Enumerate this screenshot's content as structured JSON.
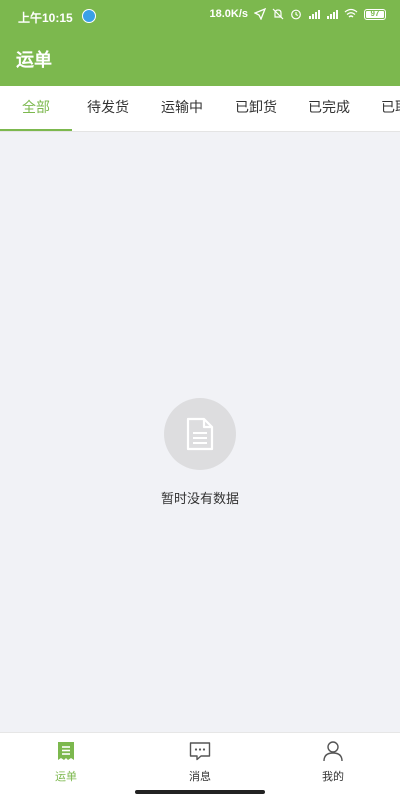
{
  "status_bar": {
    "time": "上午10:15",
    "speed": "18.0K/s",
    "battery": "97",
    "icons": [
      "check-badge-icon",
      "location-arrow-icon",
      "bell-off-icon",
      "alarm-icon",
      "hd-signal-icon",
      "signal-icon",
      "wifi-icon",
      "battery-icon"
    ]
  },
  "header": {
    "title": "运单",
    "background_color": "#7cb84e"
  },
  "tabs": [
    {
      "label": "全部",
      "active": true
    },
    {
      "label": "待发货",
      "active": false
    },
    {
      "label": "运输中",
      "active": false
    },
    {
      "label": "已卸货",
      "active": false
    },
    {
      "label": "已完成",
      "active": false
    },
    {
      "label": "已取消",
      "active": false
    }
  ],
  "empty_state": {
    "icon": "document-icon",
    "text": "暂时没有数据"
  },
  "bottom_nav": [
    {
      "label": "运单",
      "icon": "waybill-icon",
      "active": true
    },
    {
      "label": "消息",
      "icon": "message-icon",
      "active": false
    },
    {
      "label": "我的",
      "icon": "profile-icon",
      "active": false
    }
  ],
  "colors": {
    "accent": "#7cb84e",
    "background": "#f1f2f6"
  }
}
